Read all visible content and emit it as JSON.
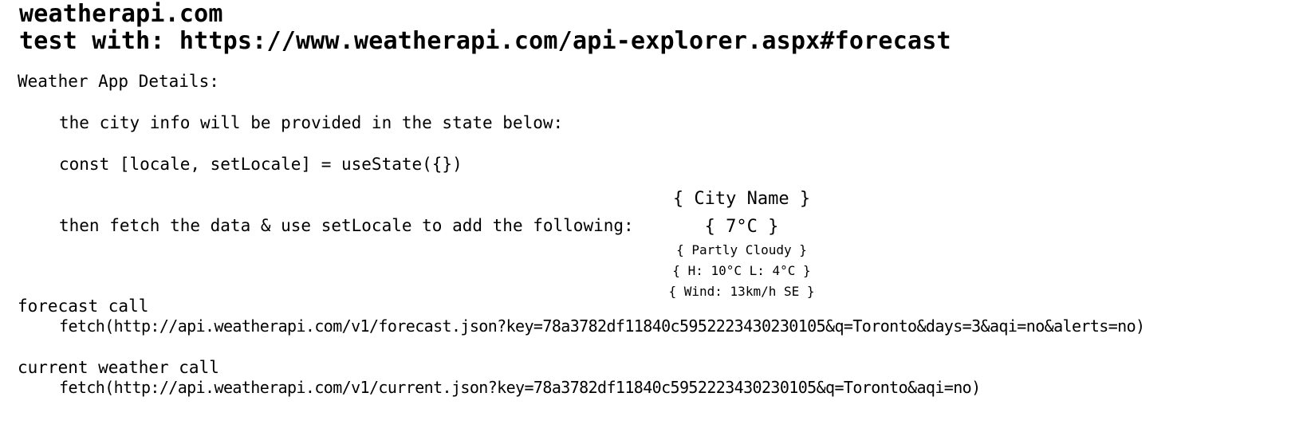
{
  "header": {
    "site": "weatherapi.com",
    "test_line": "test with: https://www.weatherapi.com/api-explorer.aspx#forecast"
  },
  "details": {
    "heading": "Weather App Details:",
    "city_info": "the city info will be provided in the state below:",
    "state_code": "const [locale, setLocale] = useState({})",
    "fetch_instruction": "then fetch the data & use setLocale to add the following:"
  },
  "weather_card": {
    "city": "{ City Name }",
    "temp": "{ 7°C }",
    "condition": "{ Partly Cloudy }",
    "high_low": "{ H: 10°C L: 4°C }",
    "wind": "{ Wind: 13km/h SE }"
  },
  "calls": {
    "forecast_label": "forecast call",
    "forecast_url": "fetch(http://api.weatherapi.com/v1/forecast.json?key=78a3782df11840c5952223430230105&q=Toronto&days=3&aqi=no&alerts=no)",
    "current_label": "current weather call",
    "current_url": "fetch(http://api.weatherapi.com/v1/current.json?key=78a3782df11840c5952223430230105&q=Toronto&aqi=no)"
  }
}
